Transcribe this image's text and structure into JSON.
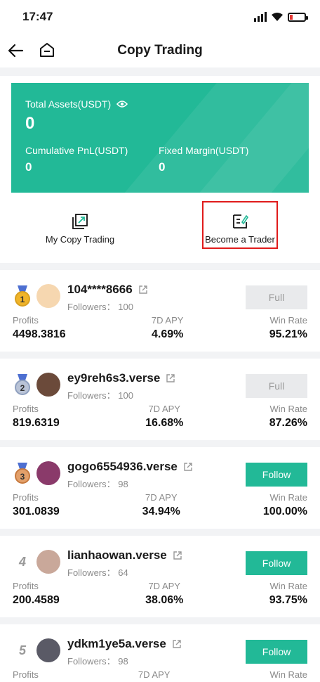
{
  "status": {
    "time": "17:47"
  },
  "nav": {
    "title": "Copy Trading"
  },
  "assets": {
    "total_label": "Total Assets(USDT)",
    "total_value": "0",
    "pnl_label": "Cumulative PnL(USDT)",
    "pnl_value": "0",
    "margin_label": "Fixed Margin(USDT)",
    "margin_value": "0",
    "accent_color": "#22b997"
  },
  "actions": {
    "my_copy_label": "My Copy Trading",
    "become_label": "Become a Trader"
  },
  "stat_labels": {
    "profits": "Profits",
    "apy": "7D APY",
    "win": "Win Rate"
  },
  "traders": [
    {
      "rank": "1",
      "rank_icon": "gold-medal-icon",
      "name": "104****8666",
      "followers": "Followers： 100",
      "profits": "4498.3816",
      "apy": "4.69%",
      "win_rate": "95.21%",
      "button": "Full",
      "button_state": "full"
    },
    {
      "rank": "2",
      "rank_icon": "silver-medal-icon",
      "name": "ey9reh6s3.verse",
      "followers": "Followers： 100",
      "profits": "819.6319",
      "apy": "16.68%",
      "win_rate": "87.26%",
      "button": "Full",
      "button_state": "full"
    },
    {
      "rank": "3",
      "rank_icon": "bronze-medal-icon",
      "name": "gogo6554936.verse",
      "followers": "Followers： 98",
      "profits": "301.0839",
      "apy": "34.94%",
      "win_rate": "100.00%",
      "button": "Follow",
      "button_state": "follow"
    },
    {
      "rank": "4",
      "rank_icon": "",
      "name": "lianhaowan.verse",
      "followers": "Followers： 64",
      "profits": "200.4589",
      "apy": "38.06%",
      "win_rate": "93.75%",
      "button": "Follow",
      "button_state": "follow"
    },
    {
      "rank": "5",
      "rank_icon": "",
      "name": "ydkm1ye5a.verse",
      "followers": "Followers： 98",
      "profits": "",
      "apy": "",
      "win_rate": "",
      "button": "Follow",
      "button_state": "follow"
    }
  ]
}
